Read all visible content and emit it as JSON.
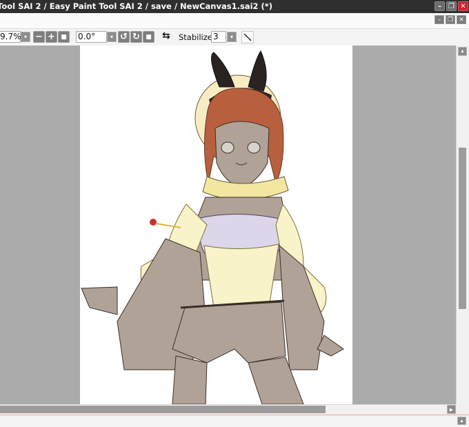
{
  "window": {
    "title": "Tool SAI 2 / Easy Paint Tool SAI 2 / save / NewCanvas1.sai2 (*)",
    "minimize_glyph": "–",
    "restore_glyph": "❐",
    "close_glyph": "✕"
  },
  "mdi": {
    "minimize_glyph": "–",
    "restore_glyph": "❐",
    "close_glyph": "✕"
  },
  "toolbar": {
    "zoom_value": "9.7%",
    "zoom_out_glyph": "−",
    "zoom_in_glyph": "+",
    "zoom_reset_glyph": "■",
    "rotation_value": "0.0°",
    "rotate_ccw_glyph": "↺",
    "rotate_cw_glyph": "↻",
    "rotate_reset_glyph": "■",
    "flip_glyph": "⇆",
    "stabilizer_label": "Stabilizer",
    "stabilizer_value": "3",
    "dropdown_glyph": "▾",
    "pen_icon": "diagonal-line-icon"
  },
  "scrollbars": {
    "up_glyph": "▲",
    "down_glyph": "▼",
    "right_glyph": "▶"
  },
  "colors": {
    "titlebar": "#2f2f2f",
    "canvas_bg": "#ababab",
    "paper": "#ffffff",
    "close_red": "#c9242b"
  }
}
